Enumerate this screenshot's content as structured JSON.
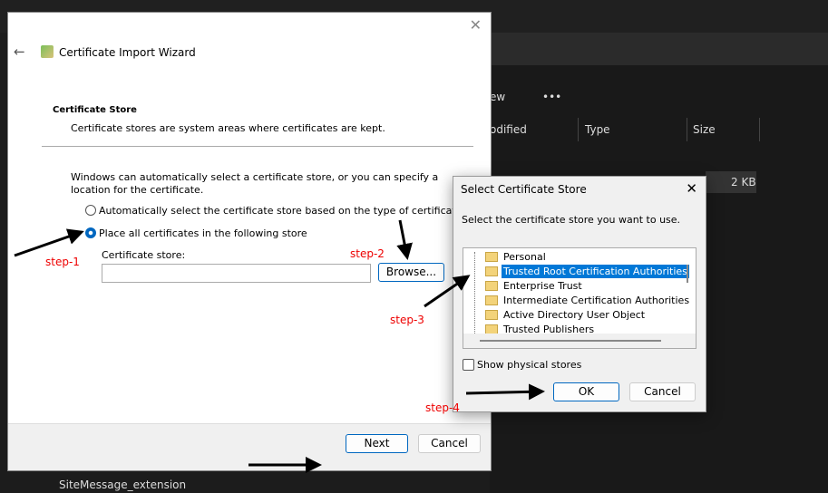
{
  "explorer": {
    "view_label": "ew",
    "more_label": "•••",
    "columns": [
      "odified",
      "Type",
      "Size"
    ],
    "file_size": "2 KB",
    "sidebar_item": "SiteMessage_extension"
  },
  "wizard": {
    "title": "Certificate Import Wizard",
    "section_title": "Certificate Store",
    "section_desc": "Certificate stores are system areas where certificates are kept.",
    "intro": "Windows can automatically select a certificate store, or you can specify a location for the certificate.",
    "radio_auto": "Automatically select the certificate store based on the type of certificate",
    "radio_manual": "Place all certificates in the following store",
    "radio_selected": "manual",
    "store_label": "Certificate store:",
    "store_value": "",
    "browse": "Browse...",
    "next": "Next",
    "cancel": "Cancel"
  },
  "dialog": {
    "title": "Select Certificate Store",
    "prompt": "Select the certificate store you want to use.",
    "stores": [
      "Personal",
      "Trusted Root Certification Authorities",
      "Enterprise Trust",
      "Intermediate Certification Authorities",
      "Active Directory User Object",
      "Trusted Publishers"
    ],
    "selected": "Trusted Root Certification Authorities",
    "show_physical": "Show physical stores",
    "show_physical_checked": false,
    "ok": "OK",
    "cancel": "Cancel"
  },
  "annotations": {
    "step1": "step-1",
    "step2": "step-2",
    "step3": "step-3",
    "step4": "step-4"
  },
  "colors": {
    "accent": "#0067c0",
    "annotation": "#e00000"
  }
}
